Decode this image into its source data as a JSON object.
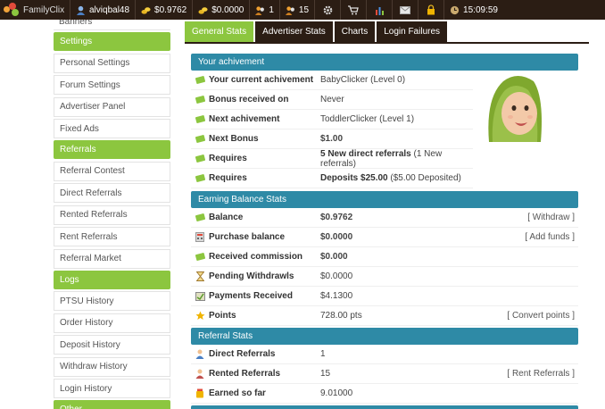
{
  "topbar": {
    "logo_text": "FamilyClix",
    "username": "alviqbal48",
    "balance": "$0.9762",
    "purchase_balance": "$0.0000",
    "count1": "1",
    "count2": "15",
    "time": "15:09:59"
  },
  "sidebar": {
    "partial_item": "Banners",
    "sections": [
      {
        "title": "Settings",
        "items": [
          "Personal Settings",
          "Forum Settings",
          "Advertiser Panel",
          "Fixed Ads"
        ]
      },
      {
        "title": "Referrals",
        "items": [
          "Referral Contest",
          "Direct Referrals",
          "Rented Referrals",
          "Rent Referrals",
          "Referral Market"
        ]
      },
      {
        "title": "Logs",
        "items": [
          "PTSU History",
          "Order History",
          "Deposit History",
          "Withdraw History",
          "Login History"
        ]
      },
      {
        "title": "Other",
        "items": []
      }
    ]
  },
  "tabs": [
    "General Stats",
    "Advertiser Stats",
    "Charts",
    "Login Failures"
  ],
  "achievement": {
    "title": "Your achivement",
    "rows": [
      {
        "label": "Your current achivement",
        "value": "BabyClicker (Level 0)"
      },
      {
        "label": "Bonus received on",
        "value": "Never"
      },
      {
        "label": "Next achivement",
        "value": "ToddlerClicker (Level 1)"
      },
      {
        "label": "Next Bonus",
        "value": "$1.00"
      },
      {
        "label": "Requires",
        "value_bold": "5 New direct referrals",
        "value_extra": "(1 New referrals)"
      },
      {
        "label": "Requires",
        "value_bold": "Deposits $25.00",
        "value_extra": "($5.00 Deposited)"
      }
    ]
  },
  "earning": {
    "title": "Earning Balance Stats",
    "rows": [
      {
        "label": "Balance",
        "value": "$0.9762",
        "action": "[ Withdraw ]"
      },
      {
        "label": "Purchase balance",
        "value": "$0.0000",
        "action": "[ Add funds ]"
      },
      {
        "label": "Received commission",
        "value": "$0.000",
        "action": ""
      },
      {
        "label": "Pending Withdrawls",
        "value": "$0.0000",
        "action": ""
      },
      {
        "label": "Payments Received",
        "value": "$4.1300",
        "action": ""
      },
      {
        "label": "Points",
        "value": "728.00 pts",
        "action": "[ Convert points ]"
      }
    ]
  },
  "referral": {
    "title": "Referral Stats",
    "rows": [
      {
        "label": "Direct Referrals",
        "value": "1",
        "action": ""
      },
      {
        "label": "Rented Referrals",
        "value": "15",
        "action": "[ Rent Referrals ]"
      },
      {
        "label": "Earned so far",
        "value": "9.01000",
        "action": ""
      }
    ]
  },
  "colors": {
    "brand_dark": "#2b1d14",
    "accent_green": "#8cc63f",
    "section_blue": "#2e8aa6"
  }
}
